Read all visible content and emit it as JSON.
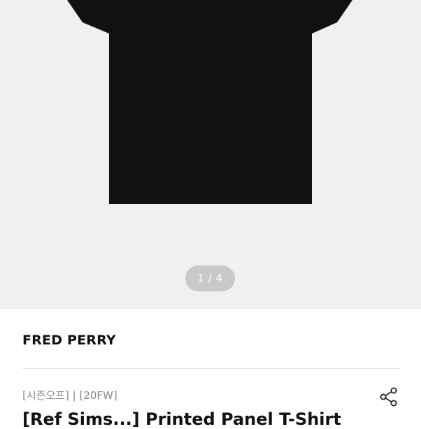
{
  "gallery": {
    "current_page": 1,
    "total_pages": 4,
    "indicator_text": "1 / 4",
    "product_color": "#111111"
  },
  "product": {
    "brand": "FRED PERRY",
    "tags": "[시즌오프] | [20FW]",
    "title": "[Ref Sims...] Printed Panel T-Shirt"
  },
  "icons": {
    "share": "share-icon"
  },
  "colors": {
    "gallery_bg": "#f0f0f0",
    "indicator_bg": "#c9c9c9",
    "tag_text": "#8a8a8a"
  }
}
